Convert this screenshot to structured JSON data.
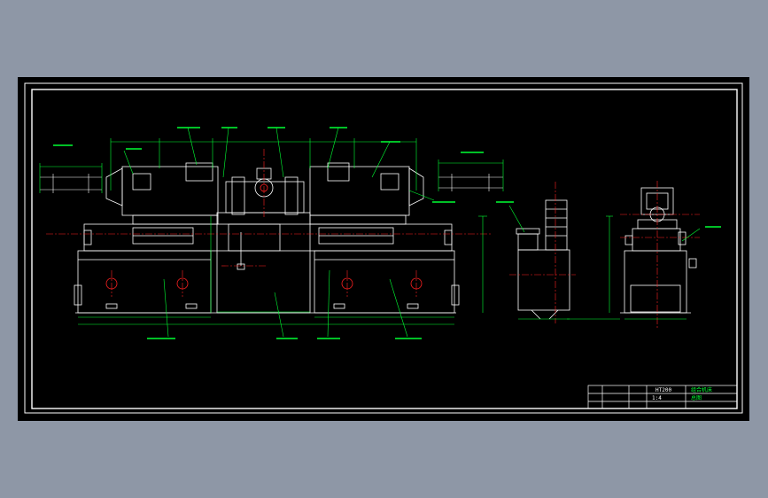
{
  "title_block": {
    "code": "HT200",
    "scale": "1:4",
    "label_a": "组合机床",
    "label_b": "总图"
  },
  "colors": {
    "frame": "#ffffff",
    "machine": "#ffffff",
    "callout": "#00ff33",
    "center_line": "#ff2020",
    "hidden": "#00e0ff"
  }
}
